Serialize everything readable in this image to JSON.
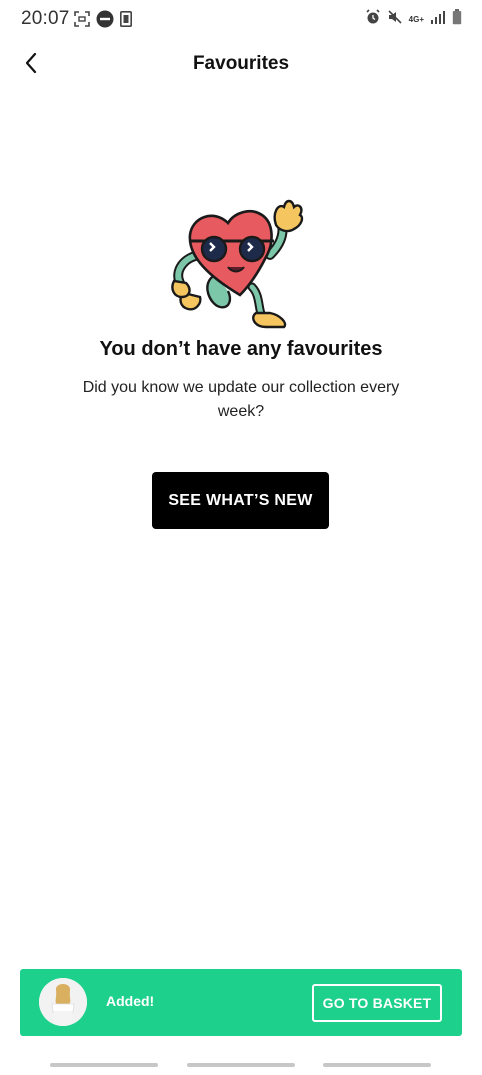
{
  "status_bar": {
    "time": "20:07",
    "network": "4G+",
    "icons": [
      "screenshot-icon",
      "do-not-disturb-icon",
      "sim-icon",
      "alarm-icon",
      "mute-icon",
      "signal-icon",
      "battery-icon"
    ]
  },
  "header": {
    "title": "Favourites",
    "back_icon": "chevron-left-icon"
  },
  "empty_state": {
    "illustration": "heart-with-sunglasses-illustration",
    "heading": "You don’t have any favourites",
    "body": "Did you know we update our collection every week?",
    "cta_label": "SEE WHAT’S NEW"
  },
  "toast": {
    "message": "Added!",
    "button_label": "GO TO BASKET",
    "color": "#1dd18c"
  },
  "nav_bar": {
    "items": [
      "recents",
      "home",
      "back"
    ]
  }
}
